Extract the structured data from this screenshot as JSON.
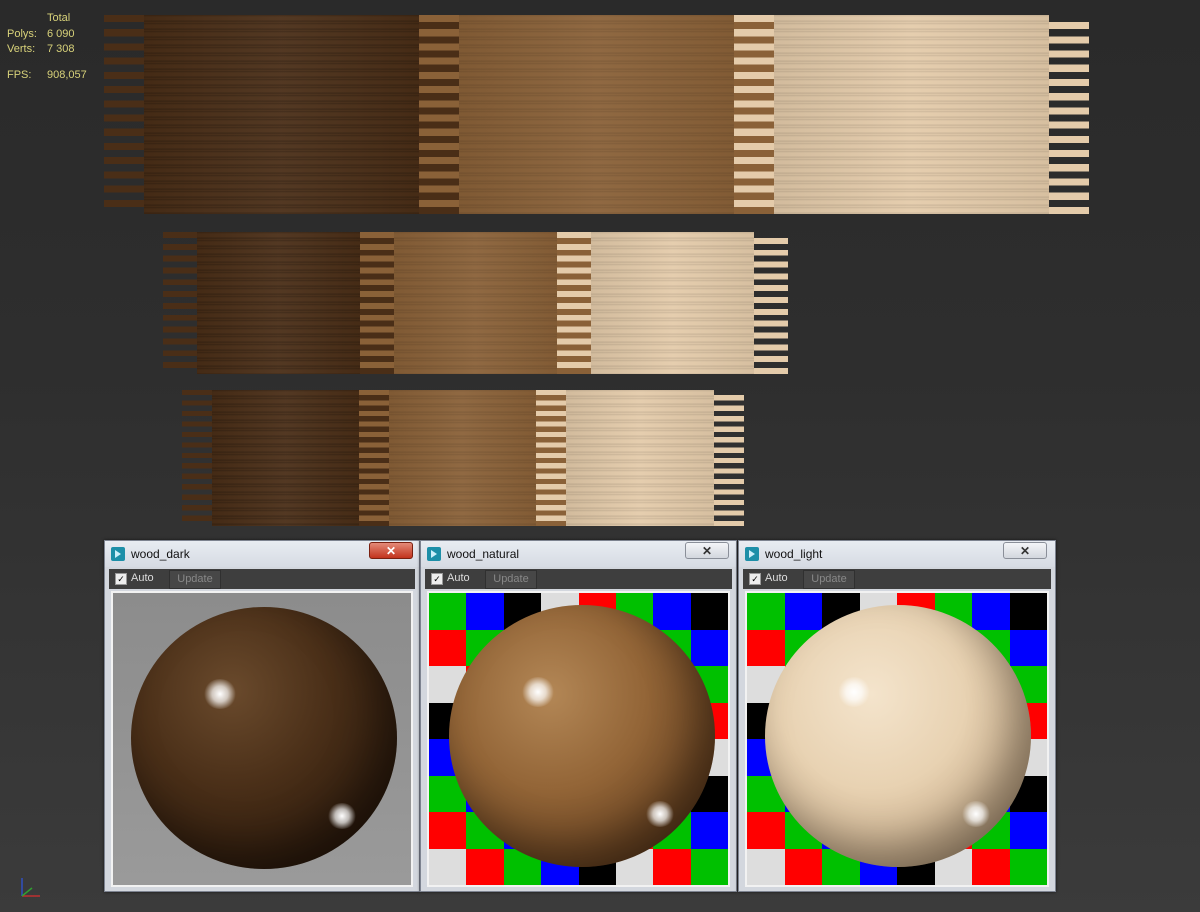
{
  "stats": {
    "header": "Total",
    "polys_label": "Polys:",
    "polys_value": "6 090",
    "verts_label": "Verts:",
    "verts_value": "7 308",
    "fps_label": "FPS:",
    "fps_value": "908,057",
    "color": "#d8d27a"
  },
  "wood_colors": {
    "dark": "#4a2e17",
    "natural": "#8a6138",
    "light": "#e4cbaa"
  },
  "material_windows": [
    {
      "title": "wood_dark",
      "auto_label": "Auto",
      "auto_checked": true,
      "update_label": "Update",
      "close_label": "✕",
      "close_active": true,
      "background": "checker-none"
    },
    {
      "title": "wood_natural",
      "auto_label": "Auto",
      "auto_checked": true,
      "update_label": "Update",
      "close_label": "✕",
      "close_active": false,
      "background": "checker"
    },
    {
      "title": "wood_light",
      "auto_label": "Auto",
      "auto_checked": true,
      "update_label": "Update",
      "close_label": "✕",
      "close_active": false,
      "background": "checker"
    }
  ],
  "checker_colors": [
    "#00c000",
    "#0000ff",
    "#000000",
    "#dddddd",
    "#ff0000"
  ],
  "icons": {
    "app": "3dsmax-icon",
    "close": "close-icon",
    "check": "checkbox-icon",
    "axis": "axis-gizmo-icon"
  }
}
